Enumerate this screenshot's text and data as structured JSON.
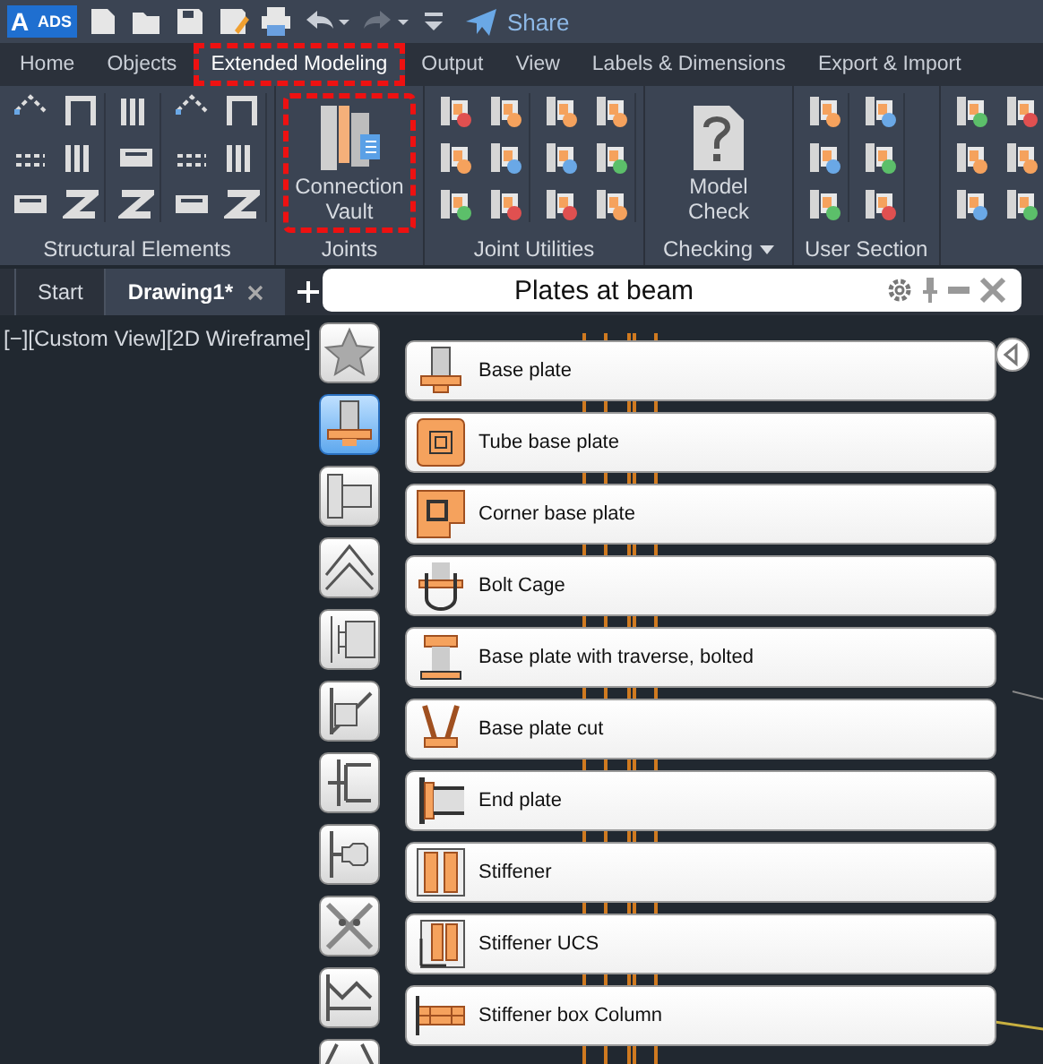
{
  "app": {
    "logo": "A",
    "badge": "ADS",
    "share": "Share"
  },
  "ribbon_tabs": [
    {
      "label": "Home",
      "selected": false,
      "highlighted": false
    },
    {
      "label": "Objects",
      "selected": false,
      "highlighted": false
    },
    {
      "label": "Extended Modeling",
      "selected": true,
      "highlighted": true
    },
    {
      "label": "Output",
      "selected": false,
      "highlighted": false
    },
    {
      "label": "View",
      "selected": false,
      "highlighted": false
    },
    {
      "label": "Labels & Dimensions",
      "selected": false,
      "highlighted": false
    },
    {
      "label": "Export & Import",
      "selected": false,
      "highlighted": false
    }
  ],
  "ribbon_panels": [
    {
      "label": "Structural Elements",
      "kind": "tools"
    },
    {
      "label": "Joints",
      "kind": "big",
      "button": "Connection Vault",
      "highlighted": true
    },
    {
      "label": "Joint Utilities",
      "kind": "tools"
    },
    {
      "label": "Checking",
      "kind": "big",
      "button": "Model Check",
      "highlighted": false,
      "dropdown": true
    },
    {
      "label": "User Section",
      "kind": "tools"
    },
    {
      "kind": "tools"
    }
  ],
  "document_tabs": [
    {
      "label": "Start",
      "selected": false
    },
    {
      "label": "Drawing1*",
      "selected": true
    }
  ],
  "viewport_label": "[−][Custom View][2D Wireframe]",
  "palette": {
    "title": "Plates at beam",
    "categories": [
      {
        "selected": false
      },
      {
        "selected": true
      },
      {
        "selected": false
      },
      {
        "selected": false
      },
      {
        "selected": false
      },
      {
        "selected": false
      },
      {
        "selected": false
      },
      {
        "selected": false
      },
      {
        "selected": false
      },
      {
        "selected": false
      },
      {
        "selected": false
      }
    ],
    "items": [
      {
        "label": "Base plate"
      },
      {
        "label": "Tube base plate"
      },
      {
        "label": "Corner base plate"
      },
      {
        "label": "Bolt Cage"
      },
      {
        "label": "Base plate with traverse, bolted"
      },
      {
        "label": "Base plate cut"
      },
      {
        "label": "End plate"
      },
      {
        "label": "Stiffener"
      },
      {
        "label": "Stiffener UCS"
      },
      {
        "label": "Stiffener box Column"
      }
    ]
  }
}
